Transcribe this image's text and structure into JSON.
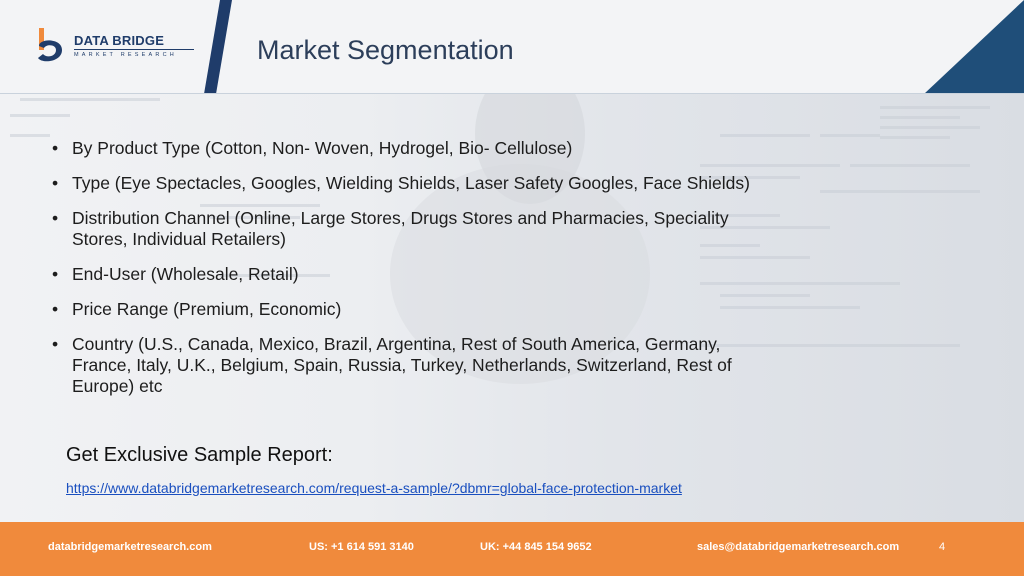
{
  "logo": {
    "name": "DATA BRIDGE",
    "subtitle": "MARKET RESEARCH"
  },
  "slide": {
    "title": "Market Segmentation"
  },
  "bullets": [
    "By Product Type (Cotton, Non- Woven, Hydrogel, Bio- Cellulose)",
    "Type (Eye Spectacles, Googles, Wielding Shields, Laser Safety Googles, Face Shields)",
    "Distribution Channel (Online, Large Stores, Drugs Stores and Pharmacies, Speciality Stores, Individual Retailers)",
    "End-User (Wholesale, Retail)",
    "Price Range (Premium, Economic)",
    "Country (U.S., Canada, Mexico, Brazil, Argentina, Rest of South America, Germany, France, Italy, U.K., Belgium, Spain, Russia, Turkey, Netherlands, Switzerland, Rest of Europe) etc"
  ],
  "bullet_symbol": "•",
  "cta": {
    "title": "Get Exclusive Sample Report:",
    "link": "https://www.databridgemarketresearch.com/request-a-sample/?dbmr=global-face-protection-market"
  },
  "footer": {
    "website": "databridgemarketresearch.com",
    "us_phone": "US: +1 614 591 3140",
    "uk_phone": "UK: +44 845 154 9652",
    "email": "sales@databridgemarketresearch.com",
    "page_number": "4"
  },
  "colors": {
    "brand_navy": "#1f3c6a",
    "accent_orange": "#f08a3c",
    "link_blue": "#1a4fbf"
  }
}
